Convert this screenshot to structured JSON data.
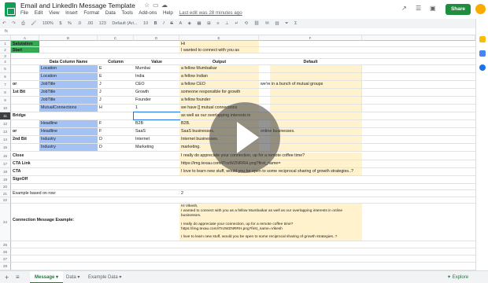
{
  "header": {
    "title": "Email and LinkedIn Message Template",
    "menu": [
      "File",
      "Edit",
      "View",
      "Insert",
      "Format",
      "Data",
      "Tools",
      "Add-ons",
      "Help"
    ],
    "last_edit": "Last edit was 28 minutes ago",
    "share_label": "Share"
  },
  "toolbar": {
    "zoom": "100%",
    "currency": "$",
    "percent": "%",
    "decimals1": ".0",
    "decimals2": ".00",
    "format": "123",
    "font": "Default (Ari...",
    "size": "10"
  },
  "columns": [
    "A",
    "B",
    "C",
    "D",
    "E",
    "F"
  ],
  "sheet": {
    "r1": {
      "a": "Salutation",
      "e": "Hi"
    },
    "r2": {
      "a": "Start",
      "e": "I wanted to connect with you as"
    },
    "r4": {
      "b": "Data Column Name",
      "c": "Column",
      "d": "Value",
      "e": "Output",
      "f": "Default"
    },
    "r5": {
      "b": "Location",
      "c": "E",
      "d": "Mumbai",
      "e": "a fellow Mumbaikar"
    },
    "r6": {
      "b": "Location",
      "c": "E",
      "d": "India",
      "e": "a fellow Indian"
    },
    "r7": {
      "a": "or",
      "b": "JobTitle",
      "c": "J",
      "d": "CEO",
      "e": "a fellow CEO",
      "f": "we're in a bunch of mutual groups"
    },
    "r8": {
      "a": "1st Bit",
      "b": "JobTitle",
      "c": "J",
      "d": "Growth",
      "e": "someone responsible for growth"
    },
    "r9": {
      "b": "JobTitle",
      "c": "J",
      "d": "Founder",
      "e": "a fellow founder"
    },
    "r10": {
      "b": "MutualConnections",
      "c": "H",
      "d": "1",
      "e": "we have [] mutual connections"
    },
    "r11": {
      "a": "Bridge",
      "e": "as well as our overlapping interests in"
    },
    "r12": {
      "b": "Headline",
      "c": "F",
      "d": "B2B",
      "e": "B2B."
    },
    "r13": {
      "a": "or",
      "b": "Headline",
      "c": "F",
      "d": "SaaS",
      "e": "SaaS businesses.",
      "f": "online businesses."
    },
    "r14": {
      "a": "2nd Bit",
      "b": "Industry",
      "c": "D",
      "d": "Internet",
      "e": "Internet businesses."
    },
    "r15": {
      "b": "Industry",
      "c": "D",
      "d": "Marketing",
      "e": "marketing."
    },
    "r16": {
      "a": "Close",
      "e": "I really do appreciate your connection, up for a remote coffee time?"
    },
    "r17": {
      "a": "CTA Link",
      "e": "https://img.texau.com/iTnzWZNRRH.png?first_name="
    },
    "r18": {
      "a": "CTA",
      "e": "I love to learn new stuff, would you be open to some reciprocal sharing of growth strategies..?"
    },
    "r19": {
      "a": "SignOff"
    },
    "r20": {
      "a": "Example based on row:",
      "e": "2"
    },
    "r22": {
      "a": "Connection Message Example:",
      "e1": "Hi Vikesh,",
      "e2": "I wanted to connect with you as a fellow Mumbaikar as well as our overlapping interests in online businesses.",
      "e3": "I really do appreciate your connection, up for a remote coffee time?",
      "e4": "https://img.texau.com/iTnzWZNRRH.png?first_name=Vikesh",
      "e5": "I love to learn new stuff, would you be open to some reciprocal sharing of growth strategies..?"
    }
  },
  "tabs": [
    "Message",
    "Data",
    "Example Data"
  ],
  "explore_label": "Explore",
  "colors": {
    "blue": "#a4c2f4",
    "yellow": "#fff2cc",
    "green": "#34a853",
    "accent": "#188038"
  }
}
